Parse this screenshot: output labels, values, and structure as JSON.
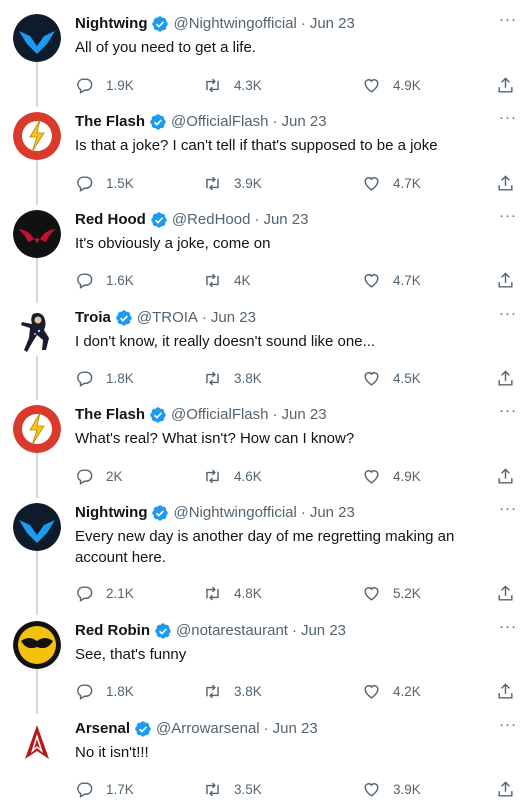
{
  "tweets": [
    {
      "name": "Nightwing",
      "handle": "@Nightwingofficial",
      "date": "Jun 23",
      "text": "All of you need to get a life.",
      "replies": "1.9K",
      "retweets": "4.3K",
      "likes": "4.9K",
      "avatar": "nightwing-avatar"
    },
    {
      "name": "The Flash",
      "handle": "@OfficialFlash",
      "date": "Jun 23",
      "text": "Is that a joke? I can't tell if that's supposed to be a joke",
      "replies": "1.5K",
      "retweets": "3.9K",
      "likes": "4.7K",
      "avatar": "flash-avatar"
    },
    {
      "name": "Red Hood",
      "handle": "@RedHood",
      "date": "Jun 23",
      "text": "It's obviously a joke, come on",
      "replies": "1.6K",
      "retweets": "4K",
      "likes": "4.7K",
      "avatar": "redhood-avatar"
    },
    {
      "name": "Troia",
      "handle": "@TROIA",
      "date": "Jun 23",
      "text": "I don't know, it really doesn't sound like one...",
      "replies": "1.8K",
      "retweets": "3.8K",
      "likes": "4.5K",
      "avatar": "troia-avatar"
    },
    {
      "name": "The Flash",
      "handle": "@OfficialFlash",
      "date": "Jun 23",
      "text": "What's real? What isn't? How can I know?",
      "replies": "2K",
      "retweets": "4.6K",
      "likes": "4.9K",
      "avatar": "flash-avatar"
    },
    {
      "name": "Nightwing",
      "handle": "@Nightwingofficial",
      "date": "Jun 23",
      "text": "Every new day is another day of me regretting making an account here.",
      "replies": "2.1K",
      "retweets": "4.8K",
      "likes": "5.2K",
      "avatar": "nightwing-avatar"
    },
    {
      "name": "Red Robin",
      "handle": "@notarestaurant",
      "date": "Jun 23",
      "text": "See, that's funny",
      "replies": "1.8K",
      "retweets": "3.8K",
      "likes": "4.2K",
      "avatar": "redrobin-avatar"
    },
    {
      "name": "Arsenal",
      "handle": "@Arrowarsenal",
      "date": "Jun 23",
      "text": "No it isn't!!!",
      "replies": "1.7K",
      "retweets": "3.5K",
      "likes": "3.9K",
      "avatar": "arsenal-avatar"
    }
  ],
  "colors": {
    "verified": "#1d9bf0",
    "muted": "#536471",
    "text": "#0f1419",
    "thread": "#cfd9de"
  }
}
